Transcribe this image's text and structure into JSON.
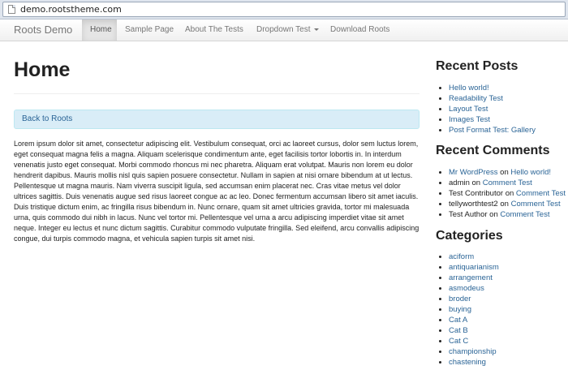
{
  "browser": {
    "url": "demo.rootstheme.com"
  },
  "navbar": {
    "brand": "Roots Demo",
    "items": [
      {
        "label": "Home",
        "active": true
      },
      {
        "label": "Sample Page"
      },
      {
        "label": "About The Tests"
      },
      {
        "label": "Dropdown Test",
        "dropdown": true
      },
      {
        "label": "Download Roots"
      }
    ]
  },
  "main": {
    "title": "Home",
    "alert_link": "Back to Roots",
    "body_text": "Lorem ipsum dolor sit amet, consectetur adipiscing elit. Vestibulum consequat, orci ac laoreet cursus, dolor sem luctus lorem, eget consequat magna felis a magna. Aliquam scelerisque condimentum ante, eget facilisis tortor lobortis in. In interdum venenatis justo eget consequat. Morbi commodo rhoncus mi nec pharetra. Aliquam erat volutpat. Mauris non lorem eu dolor hendrerit dapibus. Mauris mollis nisl quis sapien posuere consectetur. Nullam in sapien at nisi ornare bibendum at ut lectus. Pellentesque ut magna mauris. Nam viverra suscipit ligula, sed accumsan enim placerat nec. Cras vitae metus vel dolor ultrices sagittis. Duis venenatis augue sed risus laoreet congue ac ac leo. Donec fermentum accumsan libero sit amet iaculis. Duis tristique dictum enim, ac fringilla risus bibendum in. Nunc ornare, quam sit amet ultricies gravida, tortor mi malesuada urna, quis commodo dui nibh in lacus. Nunc vel tortor mi. Pellentesque vel urna a arcu adipiscing imperdiet vitae sit amet neque. Integer eu lectus et nunc dictum sagittis. Curabitur commodo vulputate fringilla. Sed eleifend, arcu convallis adipiscing congue, dui turpis commodo magna, et vehicula sapien turpis sit amet nisi."
  },
  "sidebar": {
    "recent_posts": {
      "title": "Recent Posts",
      "items": [
        "Hello world!",
        "Readability Test",
        "Layout Test",
        "Images Test",
        "Post Format Test: Gallery"
      ]
    },
    "recent_comments": {
      "title": "Recent Comments",
      "connector": "on",
      "items": [
        {
          "author": "Mr WordPress",
          "author_link": true,
          "post": "Hello world!"
        },
        {
          "author": "admin",
          "author_link": false,
          "post": "Comment Test"
        },
        {
          "author": "Test Contributor",
          "author_link": false,
          "post": "Comment Test"
        },
        {
          "author": "tellyworthtest2",
          "author_link": false,
          "post": "Comment Test"
        },
        {
          "author": "Test Author",
          "author_link": false,
          "post": "Comment Test"
        }
      ]
    },
    "categories": {
      "title": "Categories",
      "items": [
        "aciform",
        "antiquarianism",
        "arrangement",
        "asmodeus",
        "broder",
        "buying",
        "Cat A",
        "Cat B",
        "Cat C",
        "championship",
        "chastening"
      ]
    }
  },
  "colors": {
    "link": "#2a6496",
    "alert_bg": "#d9edf7",
    "alert_border": "#bce8f1"
  }
}
